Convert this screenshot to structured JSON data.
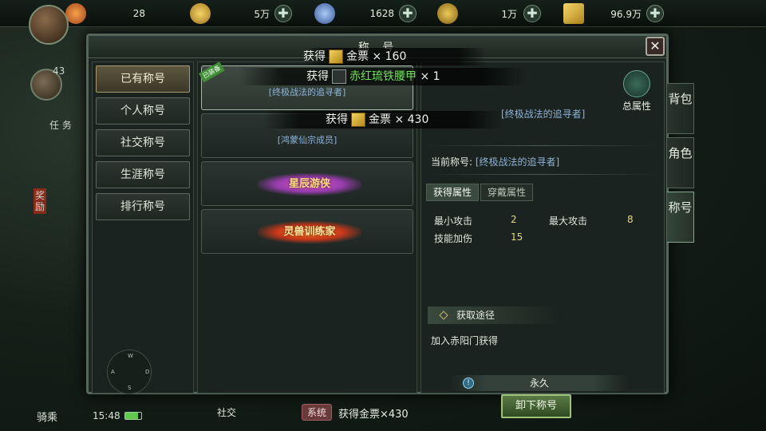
{
  "resources": [
    {
      "name": "gem",
      "amount": "28",
      "color": "#f08a3c"
    },
    {
      "name": "coin",
      "amount": "5万",
      "color": "#e7b83a"
    },
    {
      "name": "silver",
      "amount": "1628",
      "color": "#7fa8e8"
    },
    {
      "name": "copper",
      "amount": "1万",
      "color": "#d6b040"
    },
    {
      "name": "gold-ticket",
      "amount": "96.9万",
      "color": "#e6c24a"
    }
  ],
  "player": {
    "level": "43"
  },
  "dialog": {
    "title": "称 号",
    "close_label": "✕",
    "menu": [
      {
        "label": "已有称号",
        "active": true
      },
      {
        "label": "个人称号",
        "active": false
      },
      {
        "label": "社交称号",
        "active": false
      },
      {
        "label": "生涯称号",
        "active": false
      },
      {
        "label": "排行称号",
        "active": false
      }
    ],
    "compass": {
      "n": "W",
      "w": "A",
      "e": "D",
      "s": "S"
    },
    "titles": [
      {
        "desc": "[终极战法的追寻者]",
        "badge": "已装备",
        "active": true
      },
      {
        "desc": "[鸿蒙仙宗成员]",
        "badge": "",
        "active": false
      },
      {
        "banner": "星辰游侠",
        "style": "purple"
      },
      {
        "banner": "灵兽训练家",
        "style": "orange"
      }
    ],
    "detail": {
      "header_title": "[终极战法的追寻者]",
      "total_label": "总属性",
      "current_label": "当前称号:",
      "current_value": "[终极战法的追寻者]",
      "tabs": [
        {
          "label": "获得属性",
          "active": true
        },
        {
          "label": "穿戴属性",
          "active": false
        }
      ],
      "stats": [
        {
          "label": "最小攻击",
          "value": "2"
        },
        {
          "label": "最大攻击",
          "value": "8"
        },
        {
          "label": "技能加伤",
          "value": "15"
        }
      ],
      "source_title": "获取途径",
      "source_text": "加入赤阳门获得",
      "duration_icon": "!",
      "duration": "永久",
      "unequip_label": "卸下称号"
    }
  },
  "side_tabs": [
    {
      "label": "背包",
      "active": false
    },
    {
      "label": "角色",
      "active": false
    },
    {
      "label": "称号",
      "active": true
    }
  ],
  "toasts": [
    {
      "prefix": "获得",
      "item": "金票",
      "suffix": "× 160"
    },
    {
      "prefix": "获得",
      "item": "赤红琉铁腰甲",
      "suffix": "× 1"
    },
    {
      "prefix": "获得",
      "item": "金票",
      "suffix": "× 430"
    }
  ],
  "bottom": {
    "clock": "15:48",
    "chat_channel": "系统",
    "chat_text": "获得金票×430",
    "mount_label": "骑乘",
    "social_label": "社交"
  },
  "side_ui": {
    "quest_tab": "任 务",
    "reward_tab": "奖 励"
  }
}
